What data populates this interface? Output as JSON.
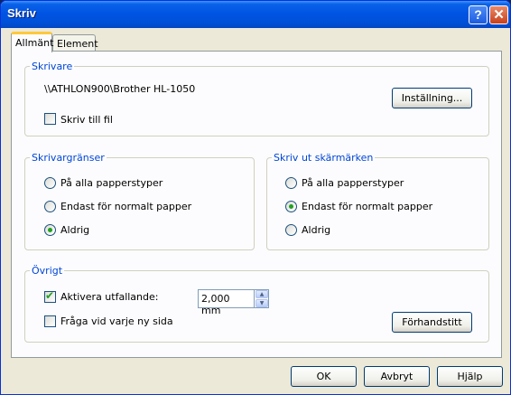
{
  "window": {
    "title": "Skriv",
    "help_glyph": "?",
    "close_glyph": "✕"
  },
  "tabs": [
    {
      "label": "Allmänt",
      "active": true
    },
    {
      "label": "Element",
      "active": false
    }
  ],
  "printer_group": {
    "title": "Skrivare",
    "printer_name": "\\\\ATHLON900\\Brother HL-1050",
    "settings_button": "Inställning...",
    "print_to_file_label": "Skriv till fil",
    "print_to_file_checked": false
  },
  "margins_group": {
    "title": "Skrivargränser",
    "options": [
      "På alla papperstyper",
      "Endast för normalt papper",
      "Aldrig"
    ],
    "selected": 2
  },
  "cropmarks_group": {
    "title": "Skriv ut skärmärken",
    "options": [
      "På alla papperstyper",
      "Endast för normalt papper",
      "Aldrig"
    ],
    "selected": 1
  },
  "other_group": {
    "title": "Övrigt",
    "bleed_label": "Aktivera utfallande:",
    "bleed_checked": true,
    "bleed_value": "2,000 mm",
    "ask_new_page_label": "Fråga vid varje ny sida",
    "ask_new_page_checked": false,
    "preview_button": "Förhandstitt"
  },
  "footer": {
    "ok_button": "OK",
    "cancel_button": "Avbryt",
    "help_button": "Hjälp"
  },
  "colors": {
    "titlebar": "#0054e3",
    "group_title": "#0046d5",
    "check_mark": "#21a121",
    "dialog_bg": "#ece9d8"
  }
}
